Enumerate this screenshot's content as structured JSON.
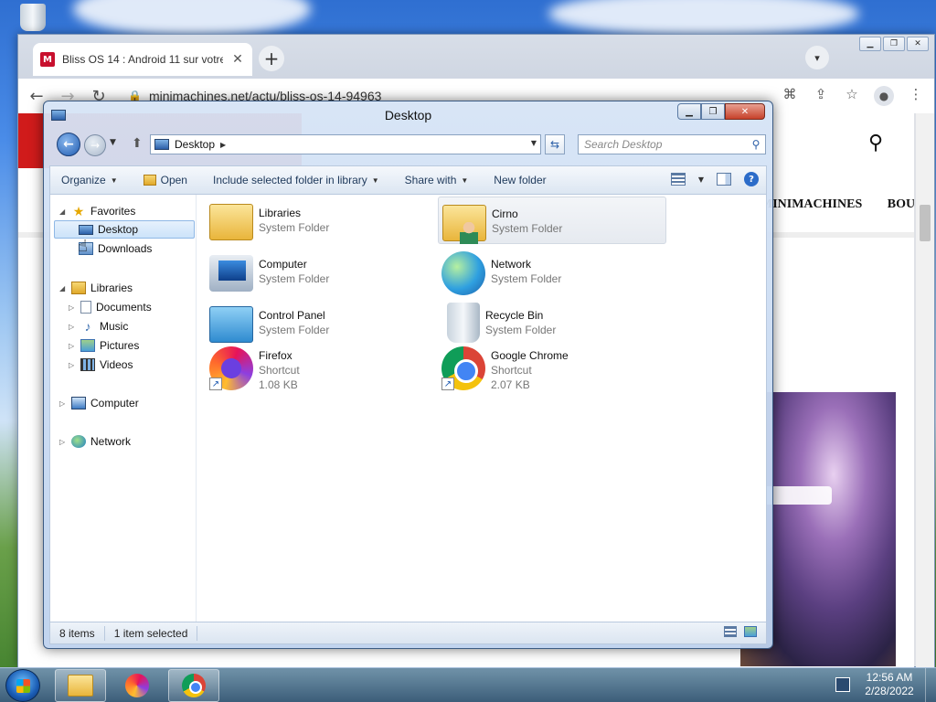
{
  "browser": {
    "tab_title": "Bliss OS 14 : Android 11 sur votre",
    "favicon_letter": "M",
    "url": "minimachines.net/actu/bliss-os-14-94963",
    "new_tab": "+",
    "tab_close": "✕"
  },
  "webpage": {
    "nav_items": [
      "MINIMACHINES",
      "BOUT"
    ]
  },
  "explorer": {
    "title": "Desktop",
    "address": "Desktop",
    "search_placeholder": "Search Desktop",
    "commands": {
      "organize": "Organize",
      "open": "Open",
      "include": "Include selected folder in library",
      "share": "Share with",
      "new_folder": "New folder"
    },
    "nav": {
      "favorites": "Favorites",
      "desktop": "Desktop",
      "downloads": "Downloads",
      "libraries": "Libraries",
      "documents": "Documents",
      "music": "Music",
      "pictures": "Pictures",
      "videos": "Videos",
      "computer": "Computer",
      "network": "Network"
    },
    "items": [
      {
        "name": "Libraries",
        "sub": "System Folder",
        "icon": "libraries-icon"
      },
      {
        "name": "Cirno",
        "sub": "System Folder",
        "icon": "user-folder-icon"
      },
      {
        "name": "Computer",
        "sub": "System Folder",
        "icon": "computer-icon"
      },
      {
        "name": "Network",
        "sub": "System Folder",
        "icon": "network-icon"
      },
      {
        "name": "Control Panel",
        "sub": "System Folder",
        "icon": "control-panel-icon"
      },
      {
        "name": "Recycle Bin",
        "sub": "System Folder",
        "icon": "recycle-bin-icon"
      },
      {
        "name": "Firefox",
        "sub": "Shortcut",
        "size": "1.08 KB",
        "icon": "firefox-icon"
      },
      {
        "name": "Google Chrome",
        "sub": "Shortcut",
        "size": "2.07 KB",
        "icon": "chrome-icon"
      }
    ],
    "status": {
      "count": "8 items",
      "selected": "1 item selected"
    }
  },
  "taskbar": {
    "time": "12:56 AM",
    "date": "2/28/2022"
  }
}
